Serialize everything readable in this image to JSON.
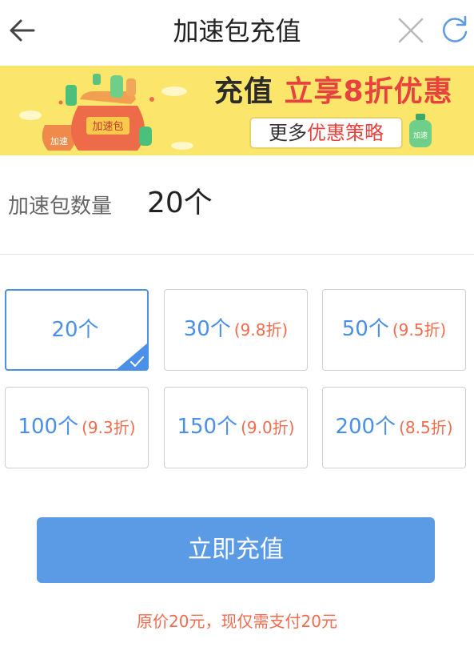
{
  "header": {
    "title": "加速包充值"
  },
  "banner": {
    "headline_dark": "充值 ",
    "headline_red": "立享8折优惠",
    "pill_text_dark": "更多",
    "pill_text_red": "优惠策略",
    "bag_label": "加速包",
    "bottle_label": "加速"
  },
  "quantity": {
    "label": "加速包数量",
    "value": "20个"
  },
  "options": [
    {
      "count": "20个",
      "discount": "",
      "selected": true
    },
    {
      "count": "30个",
      "discount": "(9.8折)",
      "selected": false
    },
    {
      "count": "50个",
      "discount": "(9.5折)",
      "selected": false
    },
    {
      "count": "100个",
      "discount": "(9.3折)",
      "selected": false
    },
    {
      "count": "150个",
      "discount": "(9.0折)",
      "selected": false
    },
    {
      "count": "200个",
      "discount": "(8.5折)",
      "selected": false
    }
  ],
  "pay_button": {
    "label": "立即充值"
  },
  "summary": "原价20元，现仅需支付20元",
  "colors": {
    "accent": "#4a8fe8",
    "button": "#5b9be6",
    "discount": "#f26b4c",
    "banner_bg": "#fbe56a"
  },
  "icons": [
    "back-arrow-icon",
    "close-icon",
    "refresh-icon",
    "checkmark-icon"
  ]
}
